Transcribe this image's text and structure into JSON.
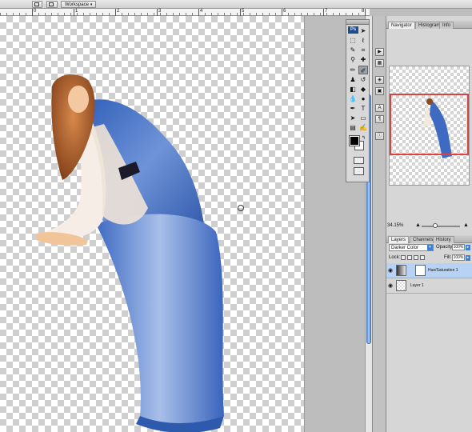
{
  "options_bar": {
    "workspace_label": "Workspace",
    "caret": "▾"
  },
  "ruler": {
    "numbers": [
      "0",
      "1",
      "2",
      "3",
      "4",
      "5",
      "6",
      "7",
      "8"
    ]
  },
  "canvas": {
    "subject": "woman-in-blue-gown-cutout"
  },
  "tools_panel": {
    "logo": "Ps",
    "swap_glyph": "↰"
  },
  "panels": {
    "top_tabs": [
      "Navigator",
      "Histogram",
      "Info"
    ],
    "zoom_value": "34.15%",
    "layer_tabs": [
      "Layers",
      "Channels",
      "History"
    ],
    "blend_mode": "Darker Color",
    "opacity_label": "Opacity:",
    "opacity_value": "100%",
    "lock_label": "Lock:",
    "fill_label": "Fill:",
    "fill_value": "100%",
    "layers": [
      {
        "name": "Hue/Saturation 1",
        "selected": true
      },
      {
        "name": "Layer 1",
        "selected": false
      }
    ]
  },
  "colors": {
    "accent": "#3f7fd1",
    "navigator_frame": "#e04040",
    "dress_blue": "#3f6fc6"
  }
}
